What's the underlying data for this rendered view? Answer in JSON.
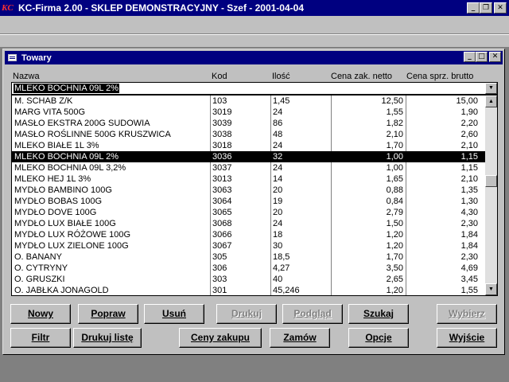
{
  "app": {
    "logo": "KC",
    "title": "KC-Firma 2.00 - SKLEP DEMONSTRACYJNY - Szef - 2001-04-04",
    "min": "_",
    "restore": "❐",
    "close": "✕"
  },
  "window": {
    "title": "Towary",
    "min": "_",
    "max": "□",
    "close": "✕"
  },
  "columns": {
    "name": "Nazwa",
    "kod": "Kod",
    "ilosc": "Ilość",
    "cena_zak": "Cena zak. netto",
    "cena_sprz": "Cena sprz. brutto"
  },
  "search": {
    "value": "MLEKO BOCHNIA 09L 2%"
  },
  "rows": [
    {
      "name": "M. SCHAB Z/K",
      "kod": "103",
      "ilosc": "1,45",
      "cz": "12,50",
      "cs": "15,00"
    },
    {
      "name": "MARG VITA 500G",
      "kod": "3019",
      "ilosc": "24",
      "cz": "1,55",
      "cs": "1,90"
    },
    {
      "name": "MASŁO EKSTRA 200G SUDOWIA",
      "kod": "3039",
      "ilosc": "86",
      "cz": "1,82",
      "cs": "2,20"
    },
    {
      "name": "MASŁO ROŚLINNE 500G KRUSZWICA",
      "kod": "3038",
      "ilosc": "48",
      "cz": "2,10",
      "cs": "2,60"
    },
    {
      "name": "MLEKO BIAŁE 1L 3%",
      "kod": "3018",
      "ilosc": "24",
      "cz": "1,70",
      "cs": "2,10"
    },
    {
      "name": "MLEKO BOCHNIA 09L 2%",
      "kod": "3036",
      "ilosc": "32",
      "cz": "1,00",
      "cs": "1,15"
    },
    {
      "name": "MLEKO BOCHNIA 09L 3,2%",
      "kod": "3037",
      "ilosc": "24",
      "cz": "1,00",
      "cs": "1,15"
    },
    {
      "name": "MLEKO HEJ 1L 3%",
      "kod": "3013",
      "ilosc": "14",
      "cz": "1,65",
      "cs": "2,10"
    },
    {
      "name": "MYDŁO BAMBINO 100G",
      "kod": "3063",
      "ilosc": "20",
      "cz": "0,88",
      "cs": "1,35"
    },
    {
      "name": "MYDŁO BOBAS 100G",
      "kod": "3064",
      "ilosc": "19",
      "cz": "0,84",
      "cs": "1,30"
    },
    {
      "name": "MYDŁO DOVE 100G",
      "kod": "3065",
      "ilosc": "20",
      "cz": "2,79",
      "cs": "4,30"
    },
    {
      "name": "MYDŁO LUX BIAŁE 100G",
      "kod": "3068",
      "ilosc": "24",
      "cz": "1,50",
      "cs": "2,30"
    },
    {
      "name": "MYDŁO LUX RÓŻOWE 100G",
      "kod": "3066",
      "ilosc": "18",
      "cz": "1,20",
      "cs": "1,84"
    },
    {
      "name": "MYDŁO LUX ZIELONE 100G",
      "kod": "3067",
      "ilosc": "30",
      "cz": "1,20",
      "cs": "1,84"
    },
    {
      "name": "O. BANANY",
      "kod": "305",
      "ilosc": "18,5",
      "cz": "1,70",
      "cs": "2,30"
    },
    {
      "name": "O. CYTRYNY",
      "kod": "306",
      "ilosc": "4,27",
      "cz": "3,50",
      "cs": "4,69"
    },
    {
      "name": "O. GRUSZKI",
      "kod": "303",
      "ilosc": "40",
      "cz": "2,65",
      "cs": "3,45"
    },
    {
      "name": "O. JABŁKA JONAGOLD",
      "kod": "301",
      "ilosc": "45,246",
      "cz": "1,20",
      "cs": "1,55"
    }
  ],
  "selected_index": 5,
  "buttons": {
    "nowy": "Nowy",
    "popraw": "Popraw",
    "usun": "Usuń",
    "drukuj": "Drukuj",
    "podglad": "Podgląd",
    "szukaj": "Szukaj",
    "wybierz": "Wybierz",
    "filtr": "Filtr",
    "drukuj_liste": "Drukuj listę",
    "ceny_zakupu": "Ceny zakupu",
    "zamow": "Zamów",
    "opcje": "Opcje",
    "wyjscie": "Wyjście"
  },
  "icons": {
    "combo_arrow": "▼",
    "scroll_up": "▲",
    "scroll_down": "▼"
  }
}
